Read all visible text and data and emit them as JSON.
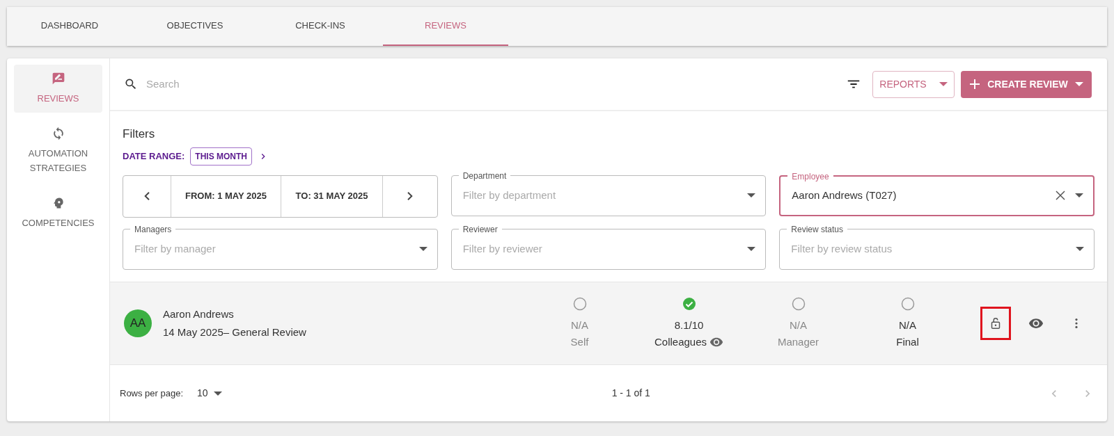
{
  "tabs": [
    {
      "label": "DASHBOARD",
      "selected": false
    },
    {
      "label": "OBJECTIVES",
      "selected": false
    },
    {
      "label": "CHECK-INS",
      "selected": false
    },
    {
      "label": "REVIEWS",
      "selected": true
    }
  ],
  "sidebar": {
    "items": [
      {
        "kind": "reviews",
        "label": "REVIEWS",
        "selected": true
      },
      {
        "kind": "automation",
        "label": "AUTOMATION STRATEGIES",
        "selected": false
      },
      {
        "kind": "competencies",
        "label": "COMPETENCIES",
        "selected": false
      }
    ]
  },
  "toolbar": {
    "search": {
      "placeholder": "Search"
    },
    "reports_button": "REPORTS",
    "create_button": "CREATE REVIEW"
  },
  "filters": {
    "title": "Filters",
    "date_range_label": "DATE RANGE:",
    "date_range_value": "THIS MONTH",
    "from": "FROM: 1 MAY 2025",
    "to": "TO: 31 MAY 2025",
    "fields": [
      {
        "label": "Department",
        "placeholder": "Filter by department",
        "focused": false
      },
      {
        "label": "Employee",
        "value": "Aaron Andrews (T027)",
        "focused": true
      },
      {
        "label": "Managers",
        "placeholder": "Filter by manager",
        "focused": false
      },
      {
        "label": "Reviewer",
        "placeholder": "Filter by reviewer",
        "focused": false
      },
      {
        "label": "Review status",
        "placeholder": "Filter by review status",
        "focused": false
      }
    ]
  },
  "reviews": [
    {
      "initials": "AA",
      "name": "Aaron Andrews",
      "subtitle": "14 May 2025– General Review",
      "stages": [
        {
          "score": "N/A",
          "label": "Self",
          "completed": false,
          "highlighted": false,
          "viewable": false
        },
        {
          "score": "8.1/10",
          "label": "Colleagues",
          "completed": true,
          "highlighted": true,
          "viewable": true
        },
        {
          "score": "N/A",
          "label": "Manager",
          "completed": false,
          "highlighted": false,
          "viewable": false
        },
        {
          "score": "N/A",
          "label": "Final",
          "completed": false,
          "highlighted": true,
          "viewable": false
        }
      ],
      "actions": [
        {
          "kind": "lock",
          "outlined": true
        },
        {
          "kind": "view",
          "outlined": false
        },
        {
          "kind": "more",
          "outlined": false
        }
      ]
    }
  ],
  "pagination": {
    "rows_label": "Rows per page:",
    "rows_value": "10",
    "range": "1 - 1 of 1"
  }
}
